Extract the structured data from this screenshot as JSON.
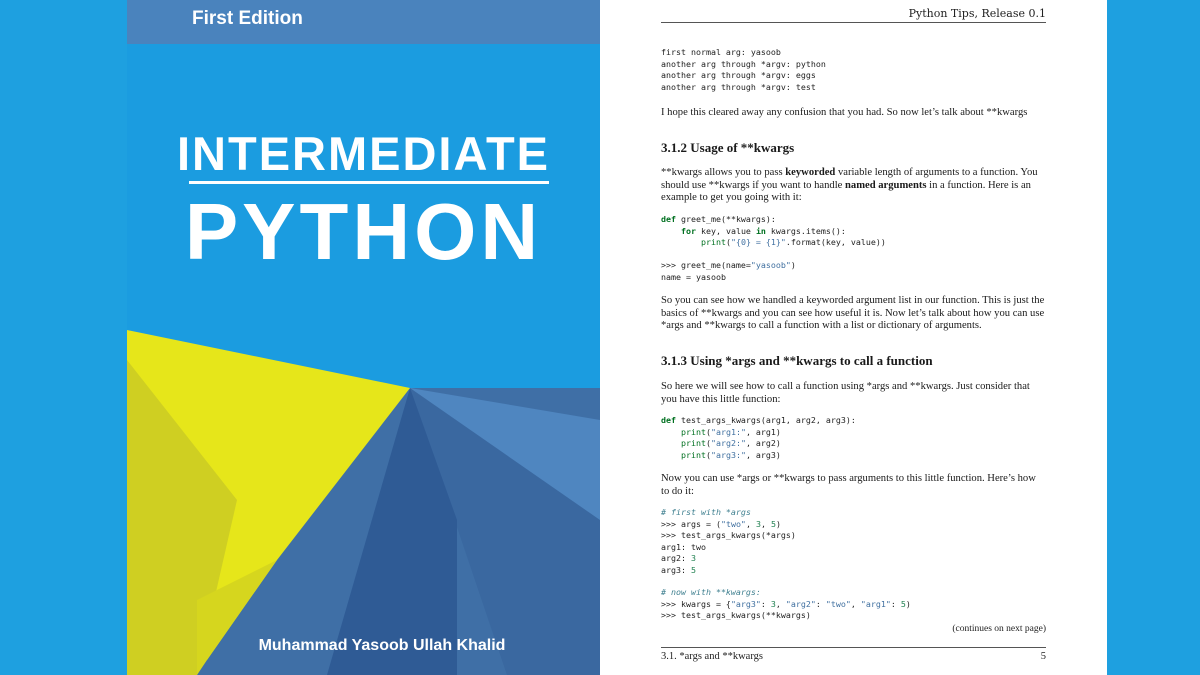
{
  "cover": {
    "edition": "First Edition",
    "title_line1": "INTERMEDIATE",
    "title_line2": "PYTHON",
    "author": "Muhammad Yasoob Ullah Khalid",
    "colors": {
      "background": "#1b9ce0",
      "band": "#4a83bd",
      "yellow": "#e6e61a",
      "steel_blue": "#3f6fa6"
    }
  },
  "page": {
    "running_head": "Python Tips, Release 0.1",
    "output1": [
      "first normal arg: yasoob",
      "another arg through *argv: python",
      "another arg through *argv: eggs",
      "another arg through *argv: test"
    ],
    "p1": "I hope this cleared away any confusion that you had. So now let’s talk about **kwargs",
    "h_312": "3.1.2  Usage of **kwargs",
    "p2": {
      "a": "**kwargs allows you to pass ",
      "b": "keyworded",
      "c": " variable length of arguments to a function. You should use **kwargs if you want to handle ",
      "d": "named arguments",
      "e": " in a function. Here is an example to get you going with it:"
    },
    "code1": {
      "def": "def",
      "sig": " greet_me(**kwargs):",
      "for": "for",
      "mid": " key, value ",
      "in": "in",
      "rest": " kwargs.items():",
      "print": "print",
      "fmtstr": "\"{0} = {1}\"",
      "fmtrest": ".format(key, value))"
    },
    "repl1": {
      "prompt": ">>> greet_me(name=",
      "arg": "\"yasoob\"",
      "close": ")",
      "out": "name = yasoob"
    },
    "p3": "So you can see how we handled a keyworded argument list in our function. This is just the basics of **kwargs and you can see how useful it is. Now let’s talk about how you can use *args and **kwargs to call a function with a list or dictionary of arguments.",
    "h_313": "3.1.3  Using *args and **kwargs to call a function",
    "p4": "So here we will see how to call a function using *args and **kwargs. Just consider that you have this little function:",
    "code2": {
      "def": "def",
      "sig": " test_args_kwargs(arg1, arg2, arg3):",
      "print": "print",
      "s1": "\"arg1:\"",
      "r1": ", arg1)",
      "s2": "\"arg2:\"",
      "r2": ", arg2)",
      "s3": "\"arg3:\"",
      "r3": ", arg3)"
    },
    "p5": "Now you can use *args or **kwargs to pass arguments to this little function. Here’s how to do it:",
    "code3": {
      "c1": "# first with *args",
      "l1a": ">>> args = (",
      "l1s": "\"two\"",
      "l1b": ", ",
      "l1n1": "3",
      "l1c": ", ",
      "l1n2": "5",
      "l1d": ")",
      "l2": ">>> test_args_kwargs(*args)",
      "o1": "arg1: two",
      "o2a": "arg2: ",
      "o2n": "3",
      "o3a": "arg3: ",
      "o3n": "5",
      "c2": "# now with **kwargs:",
      "l3a": ">>> kwargs = {",
      "l3s1": "\"arg3\"",
      "l3b": ": ",
      "l3n1": "3",
      "l3c": ", ",
      "l3s2": "\"arg2\"",
      "l3d": ": ",
      "l3s3": "\"two\"",
      "l3e": ", ",
      "l3s4": "\"arg1\"",
      "l3f": ": ",
      "l3n2": "5",
      "l3g": ")",
      "l4": ">>> test_args_kwargs(**kwargs)"
    },
    "continues": "(continues on next page)",
    "footer_left": "3.1. *args and **kwargs",
    "footer_right": "5"
  }
}
